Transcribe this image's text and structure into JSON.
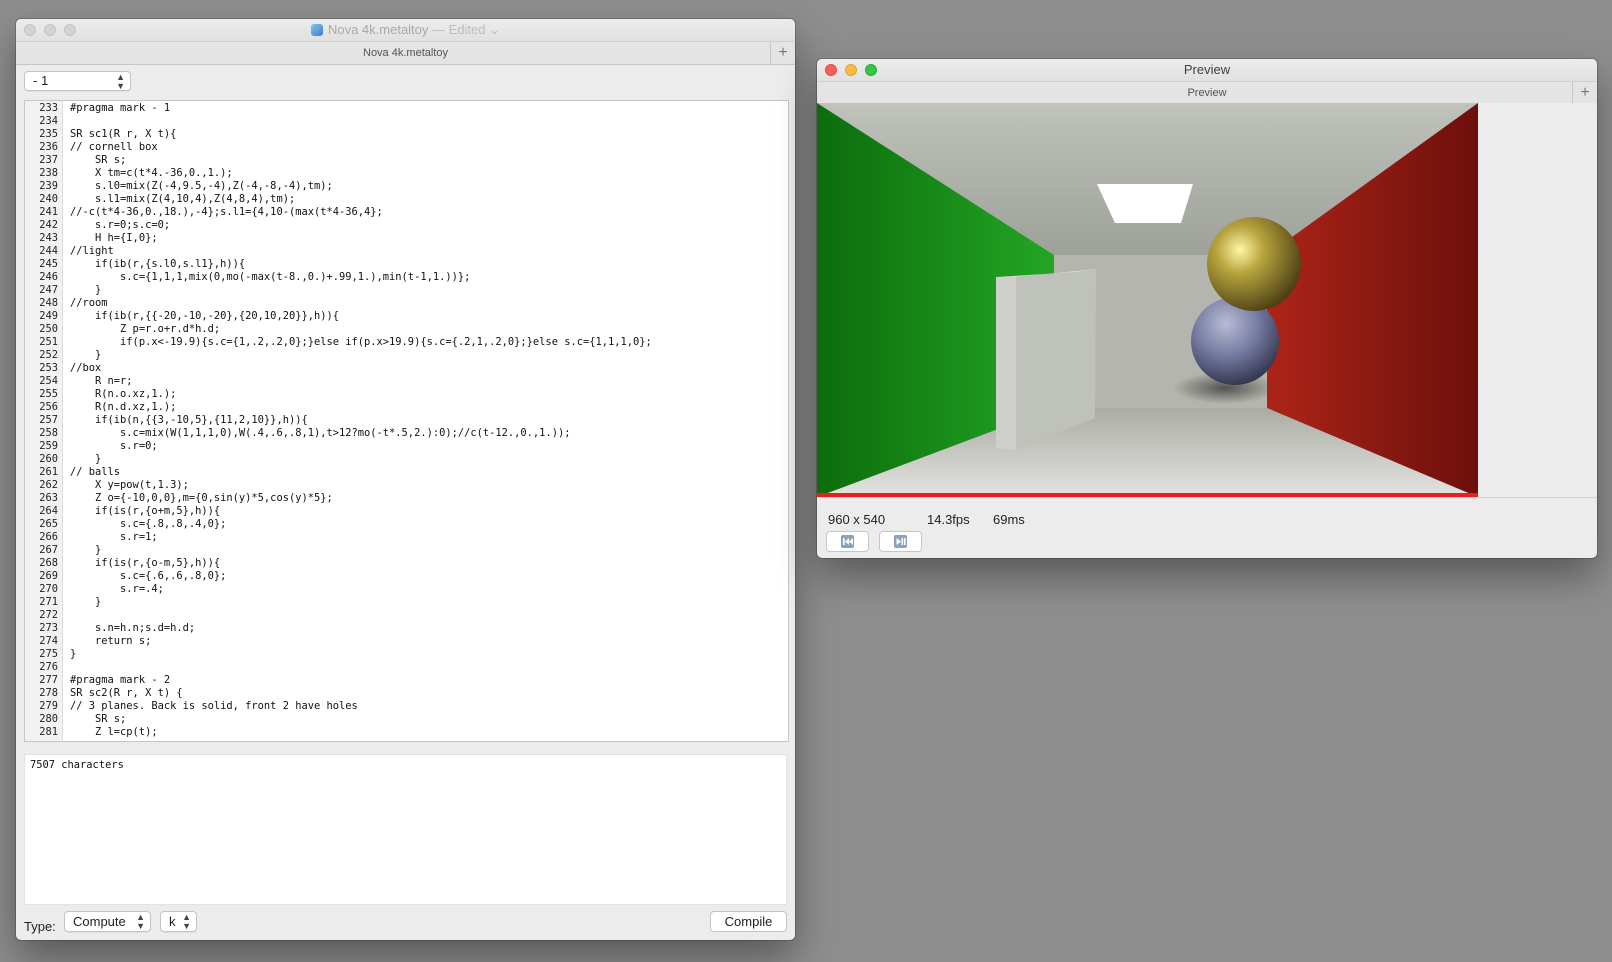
{
  "editor": {
    "title": "Nova 4k.metaltoy",
    "edited": "— Edited ⌄",
    "tab_label": "Nova 4k.metaltoy",
    "tab_add": "+",
    "section_popup": "- 1",
    "line_numbers": [
      "233",
      "234",
      "235",
      "236",
      "237",
      "238",
      "239",
      "240",
      "241",
      "242",
      "243",
      "244",
      "245",
      "246",
      "247",
      "248",
      "249",
      "250",
      "251",
      "252",
      "253",
      "254",
      "255",
      "256",
      "257",
      "258",
      "259",
      "260",
      "261",
      "262",
      "263",
      "264",
      "265",
      "266",
      "267",
      "268",
      "269",
      "270",
      "271",
      "272",
      "273",
      "274",
      "275",
      "276",
      "277",
      "278",
      "279",
      "280",
      "281"
    ],
    "code_lines": [
      "#pragma mark - 1",
      "",
      "SR sc1(R r, X t){",
      "// cornell box",
      "    SR s;",
      "    X tm=c(t*4.-36,0.,1.);",
      "    s.l0=mix(Z(-4,9.5,-4),Z(-4,-8,-4),tm);",
      "    s.l1=mix(Z(4,10,4),Z(4,8,4),tm);",
      "//-c(t*4-36,0.,18.),-4};s.l1={4,10-(max(t*4-36,4};",
      "    s.r=0;s.c=0;",
      "    H h={I,0};",
      "//light",
      "    if(ib(r,{s.l0,s.l1},h)){",
      "        s.c={1,1,1,mix(0,mo(-max(t-8.,0.)+.99,1.),min(t-1,1.))};",
      "    }",
      "//room",
      "    if(ib(r,{{-20,-10,-20},{20,10,20}},h)){",
      "        Z p=r.o+r.d*h.d;",
      "        if(p.x<-19.9){s.c={1,.2,.2,0};}else if(p.x>19.9){s.c={.2,1,.2,0};}else s.c={1,1,1,0};",
      "    }",
      "//box",
      "    R n=r;",
      "    R(n.o.xz,1.);",
      "    R(n.d.xz,1.);",
      "    if(ib(n,{{3,-10,5},{11,2,10}},h)){",
      "        s.c=mix(W(1,1,1,0),W(.4,.6,.8,1),t>12?mo(-t*.5,2.):0);//c(t-12.,0.,1.));",
      "        s.r=0;",
      "    }",
      "// balls",
      "    X y=pow(t,1.3);",
      "    Z o={-10,0,0},m={0,sin(y)*5,cos(y)*5};",
      "    if(is(r,{o+m,5},h)){",
      "        s.c={.8,.8,.4,0};",
      "        s.r=1;",
      "    }",
      "    if(is(r,{o-m,5},h)){",
      "        s.c={.6,.6,.8,0};",
      "        s.r=.4;",
      "    }",
      "",
      "    s.n=h.n;s.d=h.d;",
      "    return s;",
      "}",
      "",
      "#pragma mark - 2",
      "SR sc2(R r, X t) {",
      "// 3 planes. Back is solid, front 2 have holes",
      "    SR s;",
      "    Z l=cp(t);"
    ],
    "console_text": "7507 characters",
    "type_label": "Type:",
    "type_value": "Compute",
    "kind_value": "k",
    "compile_label": "Compile",
    "popup_up": "▲",
    "popup_down": "▼"
  },
  "preview": {
    "title": "Preview",
    "tab_label": "Preview",
    "tab_add": "+",
    "resolution": "960 x 540",
    "fps": "14.3fps",
    "frame_time": "69ms",
    "icons": [
      "rewind-icon",
      "play-pause-icon"
    ],
    "colors": {
      "left_wall": "#1f9a1f",
      "right_wall": "#a11a14",
      "progress": "#e8201a"
    }
  }
}
